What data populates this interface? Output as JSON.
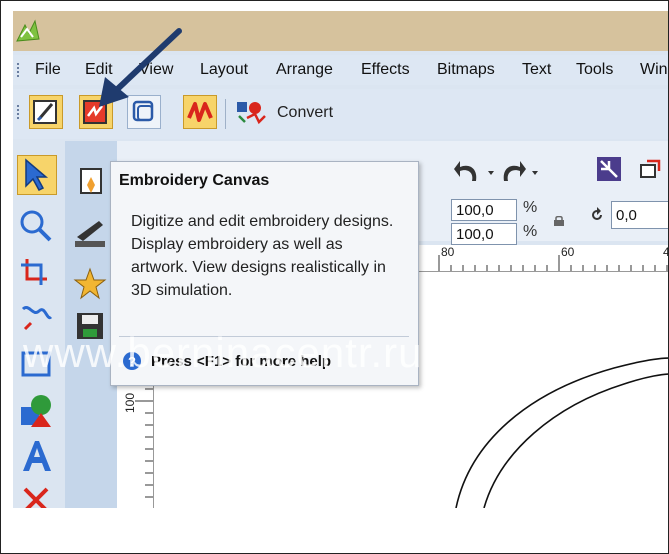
{
  "menu": {
    "items": [
      "File",
      "Edit",
      "View",
      "Layout",
      "Arrange",
      "Effects",
      "Bitmaps",
      "Text",
      "Tools",
      "Win"
    ]
  },
  "toolbar": {
    "buttons": [
      "artwork-canvas-icon",
      "embroidery-canvas-icon",
      "hoop-icon",
      "zigzag-stitch-icon"
    ],
    "convert_label": "Convert"
  },
  "properties": {
    "scale_x": "100,0",
    "scale_y": "100,0",
    "unit": "%",
    "rotation": "0,0"
  },
  "ruler": {
    "h_labels": [
      "80",
      "60",
      "4"
    ],
    "v_labels": [
      "100"
    ]
  },
  "tooltip": {
    "title": "Embroidery Canvas",
    "body": "Digitize and edit embroidery designs. Display embroidery as well as artwork. View designs realistically in 3D simulation.",
    "help": "Press <F1> for more help"
  },
  "watermark": "www.berninacentr.ru",
  "colors": {
    "titlebar": "#d6c29d",
    "toolbar": "#dde7f3",
    "highlight": "#f7d46a",
    "annotation_arrow": "#1f3b6e"
  }
}
